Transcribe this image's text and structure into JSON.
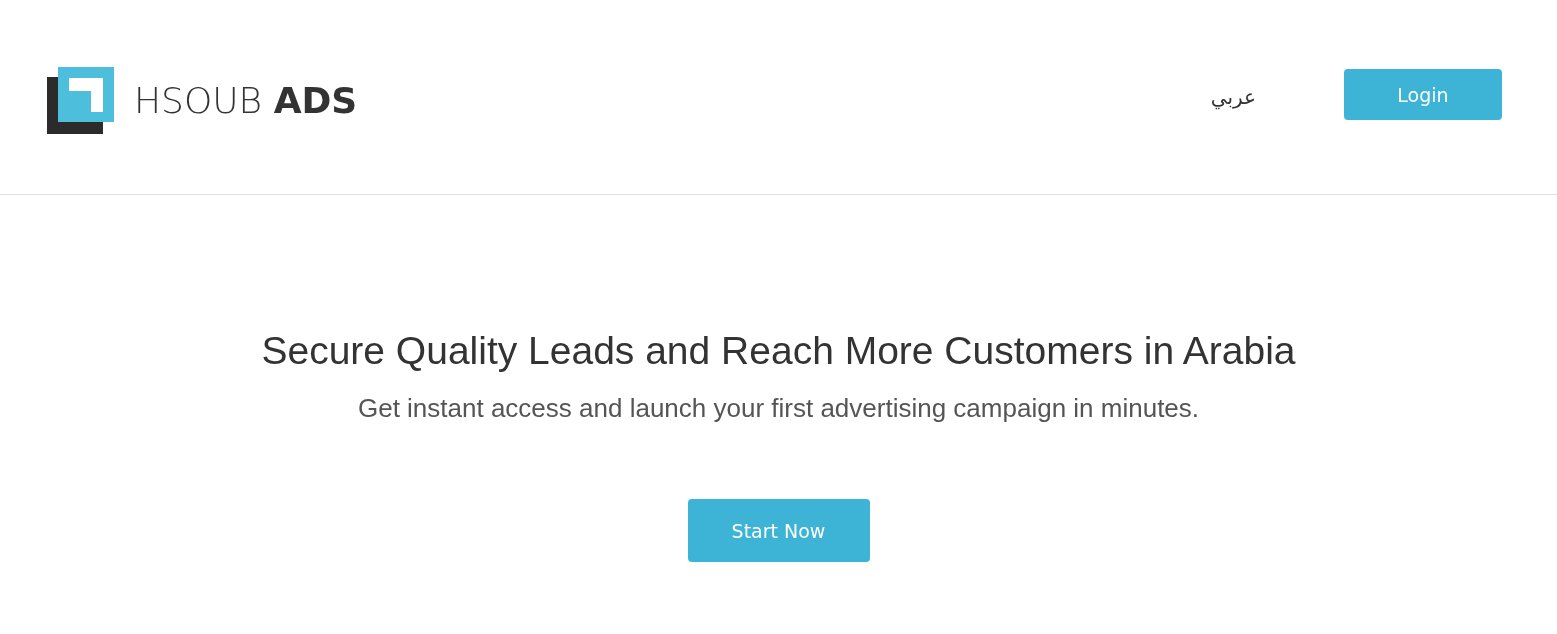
{
  "header": {
    "logo": {
      "wordmark": "HSOUB **ADS**"
    },
    "nav": {
      "language_link": "عربي",
      "login_button": "Login"
    }
  },
  "hero": {
    "headline": "Secure Quality Leads and Reach More Customers in Arabia",
    "subheadline": "Get instant access and launch your first advertising campaign in minutes.",
    "cta_button": "Start Now"
  }
}
